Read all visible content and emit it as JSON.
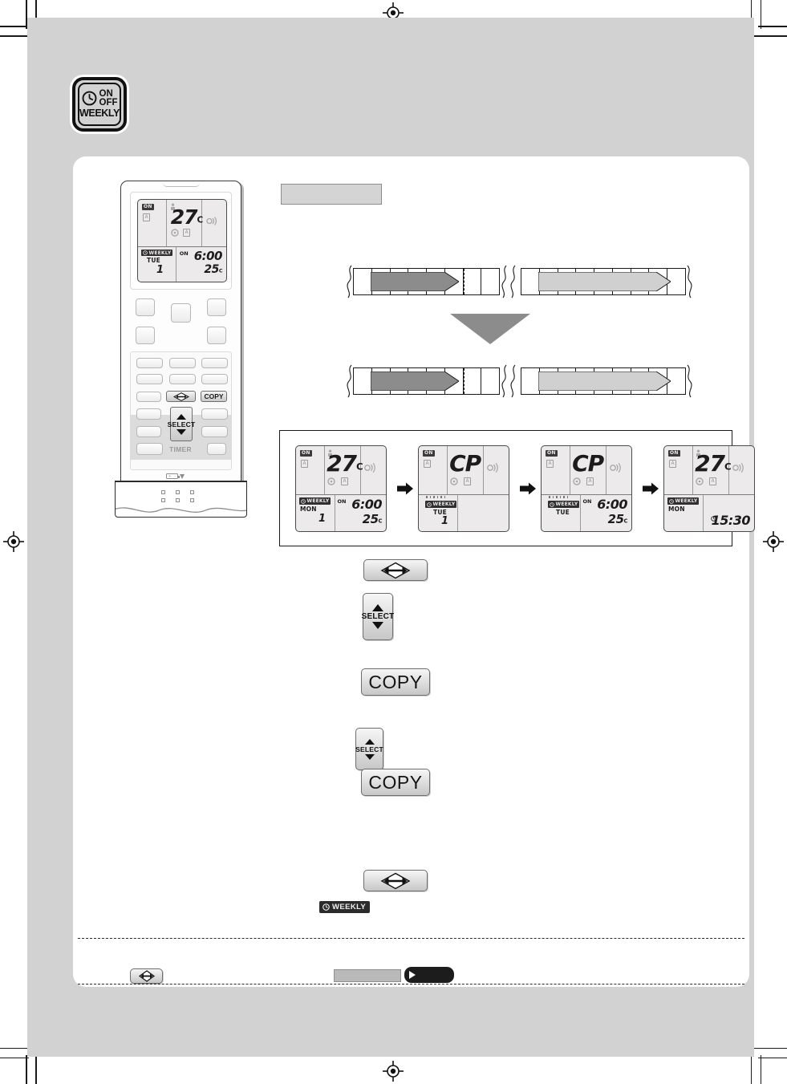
{
  "page": {
    "background_color": "#d2d2d2",
    "panel_color": "#ffffff"
  },
  "corner_icon": {
    "name": "on-off-weekly-clock-icon",
    "line1": "ON",
    "line2": "OFF",
    "line3": "WEEKLY"
  },
  "remote": {
    "lcd": {
      "on_badge": "ON",
      "mode_box": "A",
      "room_temp": "27",
      "temp_unit": "C",
      "fan_box": "A",
      "weekly_badge": "WEEKLY",
      "day": "TUE",
      "program_no": "1",
      "onoff_label": "ON",
      "time": "6:00",
      "set_temp": "25",
      "set_temp_unit": "C"
    },
    "keys": {
      "diamond": "set-arrow-icon",
      "copy": "COPY",
      "select": "SELECT",
      "timer": "TIMER"
    }
  },
  "step_label": {
    "text": ""
  },
  "timeline_top": {
    "left_arrow_color": "#8c8c8c",
    "right_arrow_color": "#d0d0d0",
    "segments": 2
  },
  "timeline_bottom": {
    "left_arrow_color": "#8c8c8c",
    "right_arrow_color": "#d0d0d0",
    "segments": 2
  },
  "sequence": {
    "arrow_glyph": "right-arrow-icon",
    "panels": [
      {
        "name": "lcd-step-1",
        "on_badge": "ON",
        "mode_box": "A",
        "main_display": "27",
        "main_unit": "C",
        "fan_box": "A",
        "weekly_badge": "WEEKLY",
        "day": "MON",
        "program_no": "1",
        "onoff_label": "ON",
        "time": "6:00",
        "set_temp": "25",
        "set_temp_unit": "C",
        "flashing": false,
        "show_clock_glyph": false
      },
      {
        "name": "lcd-step-2",
        "on_badge": "ON",
        "mode_box": "A",
        "main_display": "CP",
        "main_unit": "",
        "fan_box": "A",
        "weekly_badge": "WEEKLY",
        "day": "TUE",
        "program_no": "1",
        "onoff_label": "",
        "time": "",
        "set_temp": "",
        "set_temp_unit": "",
        "flashing": true,
        "show_clock_glyph": false
      },
      {
        "name": "lcd-step-3",
        "on_badge": "ON",
        "mode_box": "A",
        "main_display": "CP",
        "main_unit": "",
        "fan_box": "A",
        "weekly_badge": "WEEKLY",
        "day": "TUE",
        "program_no": "",
        "onoff_label": "ON",
        "time": "6:00",
        "set_temp": "25",
        "set_temp_unit": "C",
        "flashing": true,
        "show_clock_glyph": false
      },
      {
        "name": "lcd-step-4",
        "on_badge": "ON",
        "mode_box": "A",
        "main_display": "27",
        "main_unit": "C",
        "fan_box": "A",
        "weekly_badge": "WEEKLY",
        "day": "MON",
        "program_no": "",
        "onoff_label": "",
        "time": "15:30",
        "set_temp": "",
        "set_temp_unit": "",
        "flashing": false,
        "show_clock_glyph": true
      }
    ]
  },
  "instruction_keys": {
    "diamond_1": "set-arrow-icon",
    "select_1": "SELECT",
    "copy_1": "COPY",
    "select_2": "SELECT",
    "copy_2": "COPY",
    "diamond_2": "set-arrow-icon"
  },
  "weekly_inline_badge": {
    "label": "WEEKLY"
  },
  "footer": {
    "diamond_icon": "set-arrow-icon",
    "gray_box": "",
    "dark_badge_glyph": "play-triangle-icon",
    "dark_badge_text": ""
  }
}
